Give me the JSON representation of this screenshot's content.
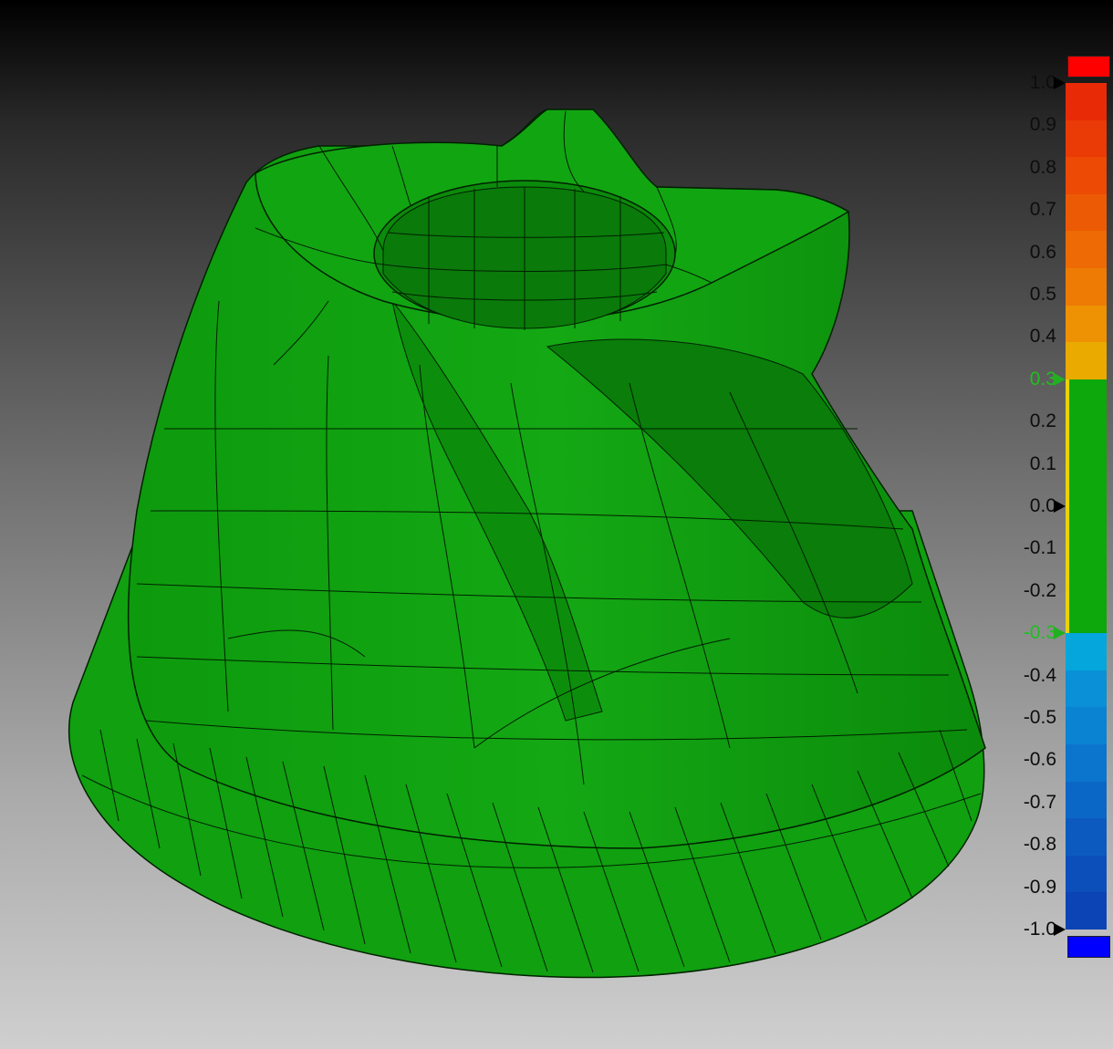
{
  "legend": {
    "ticks": [
      {
        "label": "1.0",
        "marker": true,
        "highlight": false
      },
      {
        "label": "0.9",
        "marker": false,
        "highlight": false
      },
      {
        "label": "0.8",
        "marker": false,
        "highlight": false
      },
      {
        "label": "0.7",
        "marker": false,
        "highlight": false
      },
      {
        "label": "0.6",
        "marker": false,
        "highlight": false
      },
      {
        "label": "0.5",
        "marker": false,
        "highlight": false
      },
      {
        "label": "0.4",
        "marker": false,
        "highlight": false
      },
      {
        "label": "0.3",
        "marker": true,
        "highlight": true
      },
      {
        "label": "0.2",
        "marker": false,
        "highlight": false
      },
      {
        "label": "0.1",
        "marker": false,
        "highlight": false
      },
      {
        "label": "0.0",
        "marker": true,
        "highlight": false
      },
      {
        "label": "-0.1",
        "marker": false,
        "highlight": false
      },
      {
        "label": "-0.2",
        "marker": false,
        "highlight": false
      },
      {
        "label": "-0.3",
        "marker": true,
        "highlight": true
      },
      {
        "label": "-0.4",
        "marker": false,
        "highlight": false
      },
      {
        "label": "-0.5",
        "marker": false,
        "highlight": false
      },
      {
        "label": "-0.6",
        "marker": false,
        "highlight": false
      },
      {
        "label": "-0.7",
        "marker": false,
        "highlight": false
      },
      {
        "label": "-0.8",
        "marker": false,
        "highlight": false
      },
      {
        "label": "-0.9",
        "marker": false,
        "highlight": false
      },
      {
        "label": "-1.0",
        "marker": true,
        "highlight": false
      }
    ],
    "upper_bands": [
      "#e92a06",
      "#ea3a06",
      "#ec4a05",
      "#ed5a05",
      "#ed6a04",
      "#ee7b04",
      "#ee9103",
      "#eaaa00"
    ],
    "lower_bands": [
      "#04a6dc",
      "#0990d6",
      "#0a83d2",
      "#0b74cc",
      "#0b67c6",
      "#0c5ac0",
      "#0d4fba",
      "#0d44b5"
    ],
    "tolerance_color": "#0ca80c",
    "over_color": "#ff0000",
    "under_color": "#0000ff"
  },
  "colors": {
    "model_green": "#10a010",
    "mesh_line": "#002000"
  }
}
